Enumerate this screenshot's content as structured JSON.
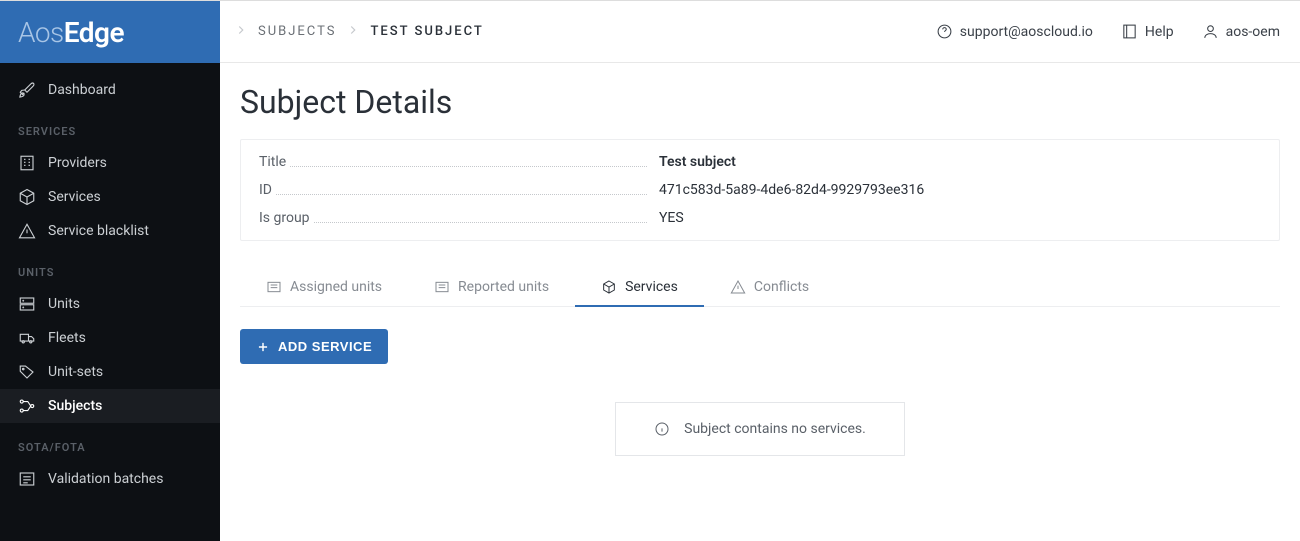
{
  "brand": {
    "part1": "Aos",
    "part2": "Edge"
  },
  "sidebar": {
    "dashboard": "Dashboard",
    "sections": {
      "services": {
        "title": "SERVICES",
        "items": [
          "Providers",
          "Services",
          "Service blacklist"
        ]
      },
      "units": {
        "title": "UNITS",
        "items": [
          "Units",
          "Fleets",
          "Unit-sets",
          "Subjects"
        ]
      },
      "sotafota": {
        "title": "SOTA/FOTA",
        "items": [
          "Validation batches"
        ]
      }
    }
  },
  "breadcrumb": {
    "parent": "SUBJECTS",
    "current": "TEST SUBJECT"
  },
  "topbar": {
    "support": "support@aoscloud.io",
    "help": "Help",
    "user": "aos-oem"
  },
  "page": {
    "title": "Subject Details"
  },
  "details": {
    "rows": [
      {
        "label": "Title",
        "value": "Test subject",
        "bold": true
      },
      {
        "label": "ID",
        "value": "471c583d-5a89-4de6-82d4-9929793ee316"
      },
      {
        "label": "Is group",
        "value": "YES"
      }
    ]
  },
  "tabs": [
    {
      "label": "Assigned units",
      "icon": "list",
      "active": false
    },
    {
      "label": "Reported units",
      "icon": "list",
      "active": false
    },
    {
      "label": "Services",
      "icon": "cube",
      "active": true
    },
    {
      "label": "Conflicts",
      "icon": "warning",
      "active": false
    }
  ],
  "actions": {
    "addService": "ADD SERVICE"
  },
  "empty": {
    "message": "Subject contains no services."
  }
}
